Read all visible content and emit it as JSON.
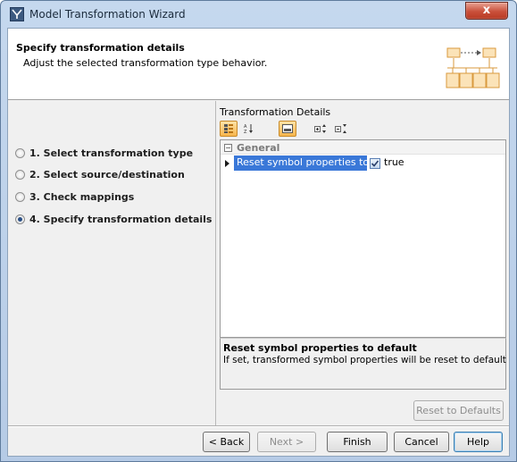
{
  "window": {
    "title": "Model Transformation Wizard",
    "close_label": "x"
  },
  "header": {
    "title": "Specify transformation details",
    "subtitle": "Adjust the selected transformation type behavior."
  },
  "steps": [
    {
      "label": "1. Select transformation type",
      "selected": false
    },
    {
      "label": "2. Select source/destination",
      "selected": false
    },
    {
      "label": "3. Check mappings",
      "selected": false
    },
    {
      "label": "4. Specify transformation details",
      "selected": true
    }
  ],
  "details": {
    "label": "Transformation Details",
    "group": "General",
    "property_name": "Reset symbol properties to ...",
    "property_value": "true",
    "checked": true,
    "description_title": "Reset symbol properties to default",
    "description_text": "If set, transformed symbol properties will be reset to default",
    "reset_button": "Reset to Defaults"
  },
  "buttons": {
    "back": "< Back",
    "next": "Next >",
    "finish": "Finish",
    "cancel": "Cancel",
    "help": "Help"
  },
  "colors": {
    "selection": "#3a78d8",
    "title_bar": "#c5d8ee",
    "close": "#c9503b"
  }
}
